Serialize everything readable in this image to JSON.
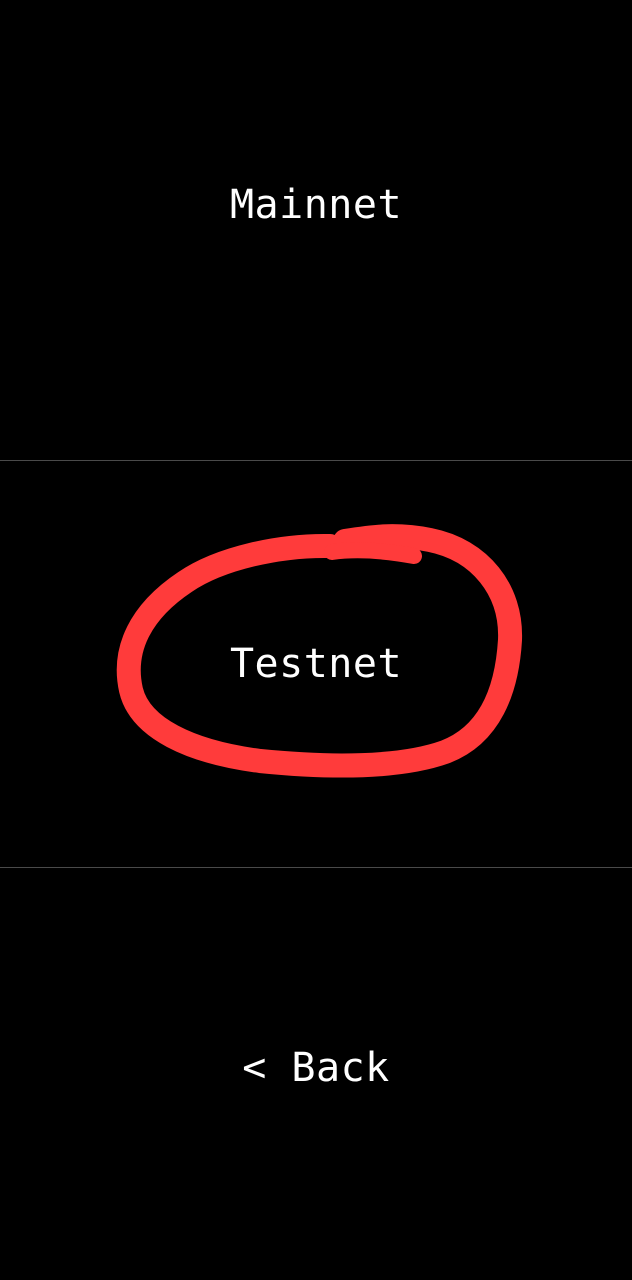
{
  "menu": {
    "items": [
      {
        "label": "Mainnet"
      },
      {
        "label": "Testnet"
      }
    ],
    "back_label": "< Back"
  },
  "annotation": {
    "color": "#ff3b3b",
    "shape": "hand-drawn circle around Testnet"
  }
}
